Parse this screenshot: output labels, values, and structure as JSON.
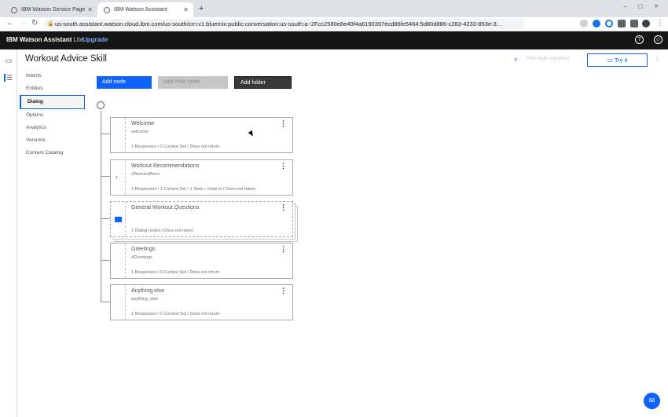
{
  "browser": {
    "tabs": [
      {
        "title": "IBM Watson Service Page"
      },
      {
        "title": "IBM Watson Assistant"
      }
    ],
    "url": "us-south.assistant.watson.cloud.ibm.com/us-south/crn:v1:bluemix:public:conversation:us-south:a~2Fcc2580e8e40f4a6190397ecd86fe5464:5d80d886-c283-4233-853e-3..."
  },
  "topnav": {
    "brand": "IBM Watson Assistant",
    "plan": "Lite",
    "upgrade": "Upgrade"
  },
  "page": {
    "title": "Workout Advice Skill",
    "search_placeholder": "Find node, condition",
    "try_it": "Try it"
  },
  "sidebar": {
    "items": [
      {
        "label": "Intents"
      },
      {
        "label": "Entities"
      },
      {
        "label": "Dialog",
        "active": true
      },
      {
        "label": "Options"
      },
      {
        "label": "Analytics"
      },
      {
        "label": "Versions"
      },
      {
        "label": "Content Catalog"
      }
    ]
  },
  "toolbar": {
    "add_node": "Add node",
    "add_child_node": "Add child node",
    "add_folder": "Add folder"
  },
  "nodes": [
    {
      "title": "Welcome",
      "condition": "welcome",
      "meta": "1 Responses / 0 Context Set / Does not return",
      "kind": "node"
    },
    {
      "title": "Workout Recommendations",
      "condition": "#WorkoutRecs",
      "meta": "2 Responses / 1 Context Set / 1 Slots / Jump to / Does not return",
      "kind": "expandable"
    },
    {
      "title": "General Workout Questions",
      "condition": "",
      "meta": "1 Dialog nodes / Does not return",
      "kind": "folder"
    },
    {
      "title": "Greetings",
      "condition": "#Greetings",
      "meta": "1 Responses / 0 Context Set / Does not return",
      "kind": "node"
    },
    {
      "title": "Anything else",
      "condition": "anything_else",
      "meta": "1 Responses / 0 Context Set / Does not return",
      "kind": "node"
    }
  ],
  "colors": {
    "accent": "#0f62fe",
    "topnav_bg": "#161616",
    "disabled": "#c6c6c6"
  }
}
